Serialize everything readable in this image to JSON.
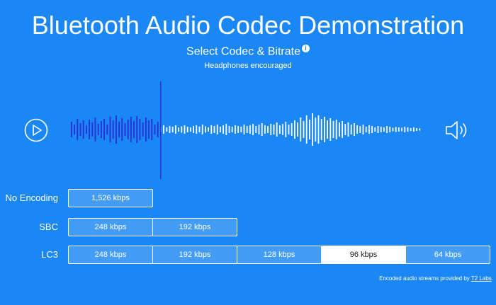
{
  "header": {
    "title": "Bluetooth Audio Codec Demonstration",
    "subtitle": "Select Codec & Bitrate",
    "info_icon": "i",
    "hint": "Headphones encouraged"
  },
  "player": {
    "play_icon": "play-circle-icon",
    "volume_icon": "speaker-icon",
    "progress": 0.25
  },
  "codecs": [
    {
      "label": "No Encoding",
      "bitrates": [
        "1,526 kbps"
      ]
    },
    {
      "label": "SBC",
      "bitrates": [
        "248 kbps",
        "192 kbps"
      ]
    },
    {
      "label": "LC3",
      "bitrates": [
        "248 kbps",
        "192 kbps",
        "128 kbps",
        "96 kbps",
        "64 kbps"
      ]
    }
  ],
  "selected": {
    "codec": "LC3",
    "bitrate": "96 kbps"
  },
  "footer": {
    "text": "Encoded audio streams provided by",
    "link": "T2 Labs",
    "suffix": "."
  },
  "colors": {
    "background": "#1a87f5",
    "played": "#2a2fd0",
    "unplayed": "#ffffff",
    "selected_bg": "#ffffff"
  }
}
